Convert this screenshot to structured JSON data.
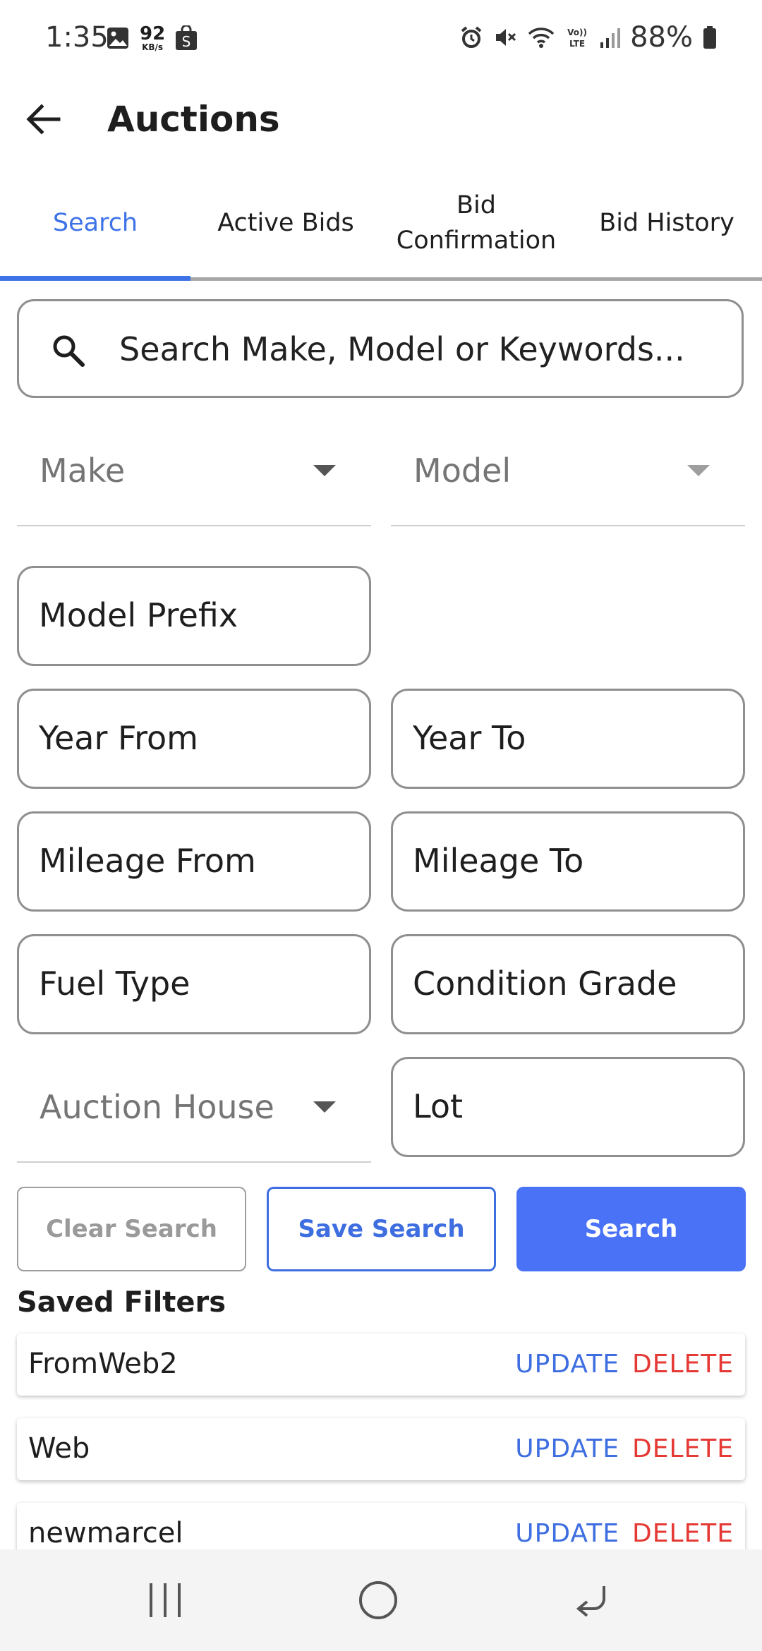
{
  "status_bar": {
    "time": "1:35",
    "net_speed_value": "92",
    "net_speed_unit": "KB/s",
    "battery": "88%"
  },
  "app_bar": {
    "title": "Auctions"
  },
  "tabs": [
    {
      "label": "Search",
      "active": true
    },
    {
      "label": "Active Bids",
      "active": false
    },
    {
      "label": "Bid Confirmation",
      "active": false
    },
    {
      "label": "Bid History",
      "active": false
    }
  ],
  "search": {
    "placeholder": "Search Make, Model or Keywords..."
  },
  "filters": {
    "make": "Make",
    "model": "Model",
    "model_prefix": "Model Prefix",
    "year_from": "Year From",
    "year_to": "Year To",
    "mileage_from": "Mileage From",
    "mileage_to": "Mileage To",
    "fuel_type": "Fuel Type",
    "condition_grade": "Condition Grade",
    "auction_house": "Auction House",
    "lot": "Lot"
  },
  "actions": {
    "clear": "Clear Search",
    "save": "Save Search",
    "search": "Search"
  },
  "saved_filters": {
    "title": "Saved Filters",
    "items": [
      {
        "name": "FromWeb2",
        "update": "UPDATE",
        "delete": "DELETE"
      },
      {
        "name": "Web",
        "update": "UPDATE",
        "delete": "DELETE"
      },
      {
        "name": "newmarcel",
        "update": "UPDATE",
        "delete": "DELETE"
      }
    ]
  },
  "colors": {
    "accent": "#3e73e8",
    "primary_button": "#4a72f6",
    "delete": "#e53935"
  }
}
